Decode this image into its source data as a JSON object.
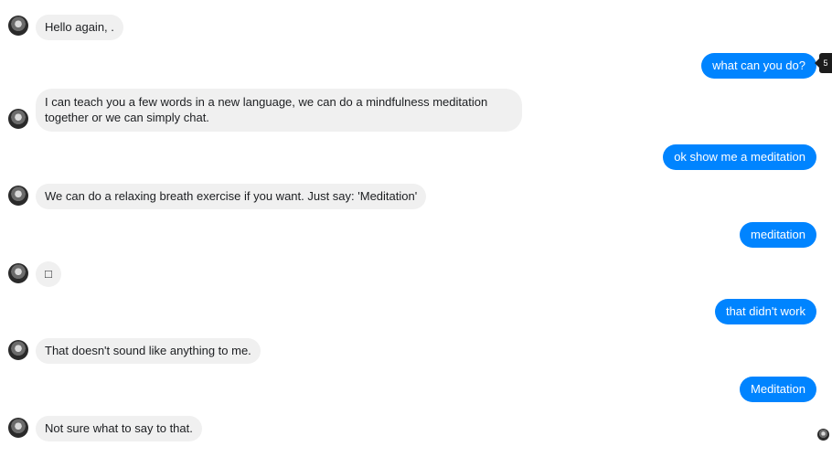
{
  "messages": [
    {
      "from": "bot",
      "text": "Hello again, ."
    },
    {
      "from": "user",
      "text": "what can you do?"
    },
    {
      "from": "bot",
      "text": "I can teach you a few words in a new language, we can do a mindfulness meditation together or we can simply chat."
    },
    {
      "from": "user",
      "text": "ok show me a meditation"
    },
    {
      "from": "bot",
      "text": "We can do a relaxing breath exercise if you want. Just say: 'Meditation'"
    },
    {
      "from": "user",
      "text": "meditation"
    },
    {
      "from": "bot",
      "text": "□"
    },
    {
      "from": "user",
      "text": "that didn't work"
    },
    {
      "from": "bot",
      "text": "That doesn't sound like anything to me."
    },
    {
      "from": "user",
      "text": "Meditation"
    },
    {
      "from": "bot",
      "text": "Not sure what to say to that."
    }
  ],
  "tooltip": {
    "text": "5"
  },
  "icons": {
    "bot_avatar": "avatar-icon",
    "read_receipt": "read-receipt-avatar-icon"
  }
}
